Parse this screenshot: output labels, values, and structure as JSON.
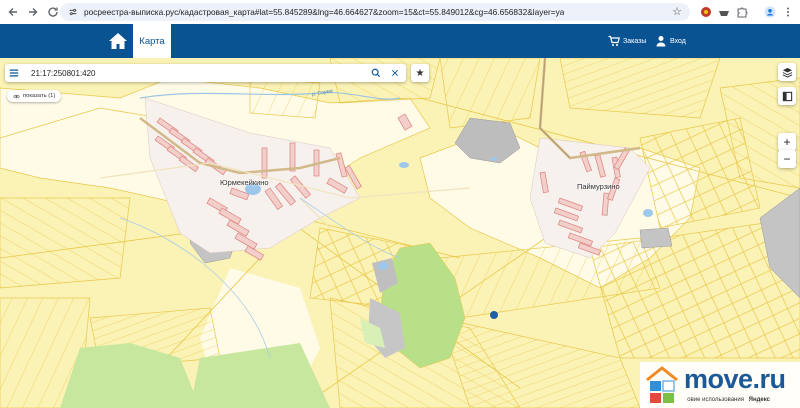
{
  "browser": {
    "url": "росреестра-выписка.рус/кадастровая_карта#lat=55.845289&lng=46.664627&zoom=15&ct=55.849012&cg=46.656832&layer=ya"
  },
  "header": {
    "map_tab_label": "Карта",
    "orders_label": "Заказы",
    "login_label": "Вход"
  },
  "search": {
    "value": "21:17:250801:420"
  },
  "show_button": {
    "label": "показать (1)"
  },
  "zoom": {
    "plus": "+",
    "minus": "−"
  },
  "map_labels": {
    "village_1": "Юрмекейкино",
    "village_2": "Паймурзино",
    "river": "р. Сорма"
  },
  "footer": {
    "terms": "овие использования",
    "yandex": "Яндекс"
  },
  "watermark": {
    "brand": "move.ru"
  },
  "colors": {
    "header_bg": "#0a5393",
    "map_bg": "#fbf2b5",
    "parcel_border": "#e8c84a",
    "settlement_parcel": "#f3cfcb",
    "forest": "#b8e088"
  }
}
